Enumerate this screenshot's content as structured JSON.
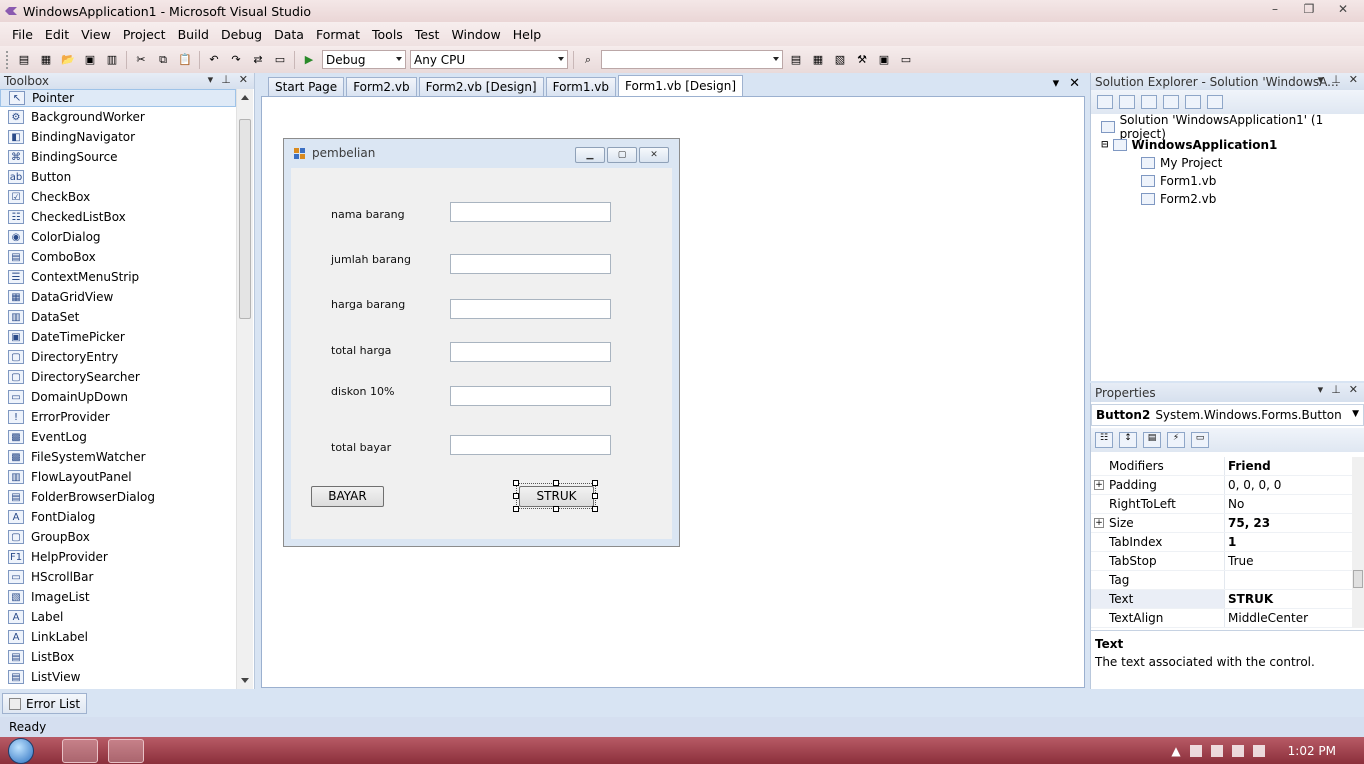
{
  "window": {
    "title": "WindowsApplication1 - Microsoft Visual Studio",
    "controls": [
      "–",
      "❐",
      "✕"
    ]
  },
  "menu": [
    "File",
    "Edit",
    "View",
    "Project",
    "Build",
    "Debug",
    "Data",
    "Format",
    "Tools",
    "Test",
    "Window",
    "Help"
  ],
  "toolbar": {
    "config": "Debug",
    "platform": "Any CPU",
    "find_value": ""
  },
  "toolbox": {
    "title": "Toolbox",
    "items": [
      "Pointer",
      "BackgroundWorker",
      "BindingNavigator",
      "BindingSource",
      "Button",
      "CheckBox",
      "CheckedListBox",
      "ColorDialog",
      "ComboBox",
      "ContextMenuStrip",
      "DataGridView",
      "DataSet",
      "DateTimePicker",
      "DirectoryEntry",
      "DirectorySearcher",
      "DomainUpDown",
      "ErrorProvider",
      "EventLog",
      "FileSystemWatcher",
      "FlowLayoutPanel",
      "FolderBrowserDialog",
      "FontDialog",
      "GroupBox",
      "HelpProvider",
      "HScrollBar",
      "ImageList",
      "Label",
      "LinkLabel",
      "ListBox",
      "ListView"
    ],
    "icons": [
      "↖",
      "⚙",
      "◧",
      "⌘",
      "ab",
      "☑",
      "☷",
      "◉",
      "▤",
      "☰",
      "▦",
      "▥",
      "▣",
      "▢",
      "▢",
      "▭",
      "!",
      "▩",
      "▩",
      "▥",
      "▤",
      "A",
      "▢",
      "F1",
      "▭",
      "▧",
      "A",
      "A",
      "▤",
      "▤"
    ]
  },
  "tabs": [
    "Start Page",
    "Form2.vb",
    "Form2.vb [Design]",
    "Form1.vb",
    "Form1.vb [Design]"
  ],
  "form": {
    "title": "pembelian",
    "labels": [
      "nama barang",
      "jumlah barang",
      "harga barang",
      "total harga",
      "diskon 10%",
      "total bayar"
    ],
    "button1": "BAYAR",
    "button2": "STRUK"
  },
  "solution_explorer": {
    "title": "Solution Explorer - Solution 'WindowsA...",
    "solution": "Solution 'WindowsApplication1' (1 project)",
    "project": "WindowsApplication1",
    "items": [
      "My Project",
      "Form1.vb",
      "Form2.vb"
    ]
  },
  "properties": {
    "title": "Properties",
    "object": "Button2",
    "object_type": "System.Windows.Forms.Button",
    "rows": [
      {
        "name": "Modifiers",
        "value": "Friend"
      },
      {
        "name": "Padding",
        "value": "0, 0, 0, 0"
      },
      {
        "name": "RightToLeft",
        "value": "No"
      },
      {
        "name": "Size",
        "value": "75, 23"
      },
      {
        "name": "TabIndex",
        "value": "1"
      },
      {
        "name": "TabStop",
        "value": "True"
      },
      {
        "name": "Tag",
        "value": ""
      },
      {
        "name": "Text",
        "value": "STRUK"
      },
      {
        "name": "TextAlign",
        "value": "MiddleCenter"
      }
    ],
    "desc_title": "Text",
    "desc_text": "The text associated with the control."
  },
  "error_list": "Error List",
  "status": "Ready",
  "clock": "1:02 PM"
}
